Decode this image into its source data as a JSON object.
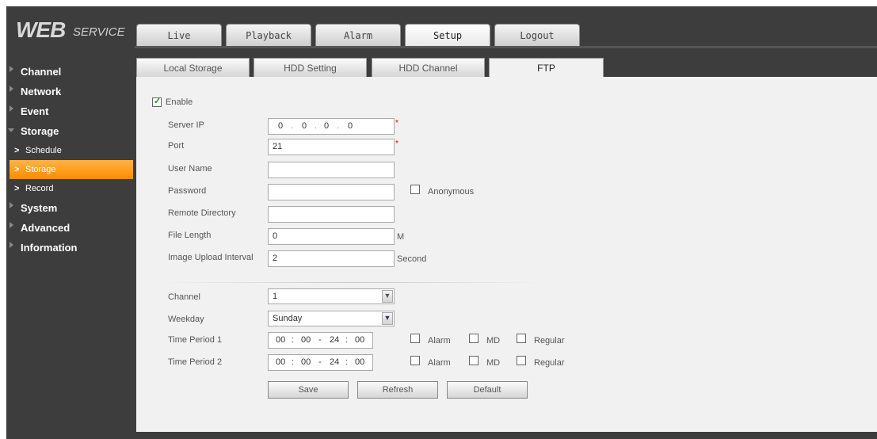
{
  "logo": {
    "brand": "WEB",
    "sub": "SERVICE"
  },
  "nav": {
    "tabs": [
      "Live",
      "Playback",
      "Alarm",
      "Setup",
      "Logout"
    ],
    "active": "Setup"
  },
  "sidebar": {
    "items": [
      {
        "label": "Channel"
      },
      {
        "label": "Network"
      },
      {
        "label": "Event"
      },
      {
        "label": "Storage"
      },
      {
        "label": "Schedule"
      },
      {
        "label": "Storage"
      },
      {
        "label": "Record"
      },
      {
        "label": "System"
      },
      {
        "label": "Advanced"
      },
      {
        "label": "Information"
      }
    ]
  },
  "subtabs": [
    "Local Storage",
    "HDD Setting",
    "HDD Channel",
    "FTP"
  ],
  "form": {
    "enable_label": "Enable",
    "server_ip_label": "Server IP",
    "server_ip": [
      "0",
      "0",
      "0",
      "0"
    ],
    "port_label": "Port",
    "port": "21",
    "user_name_label": "User Name",
    "user_name": "",
    "password_label": "Password",
    "password": "",
    "anonymous_label": "Anonymous",
    "remote_dir_label": "Remote Directory",
    "remote_dir": "",
    "file_length_label": "File Length",
    "file_length": "0",
    "file_length_unit": "M",
    "upload_interval_label": "Image Upload Interval",
    "upload_interval": "2",
    "upload_interval_unit": "Second",
    "channel_label": "Channel",
    "channel": "1",
    "weekday_label": "Weekday",
    "weekday": "Sunday",
    "period1_label": "Time Period 1",
    "period2_label": "Time Period 2",
    "period_start_h": "00",
    "period_start_m": "00",
    "period_end_h": "24",
    "period_end_m": "00",
    "alarm_label": "Alarm",
    "md_label": "MD",
    "regular_label": "Regular"
  },
  "buttons": {
    "save": "Save",
    "refresh": "Refresh",
    "default": "Default"
  },
  "colors": {
    "accent": "#ff8c00",
    "frame": "#3d3d3d",
    "panel": "#f1f1f1"
  }
}
